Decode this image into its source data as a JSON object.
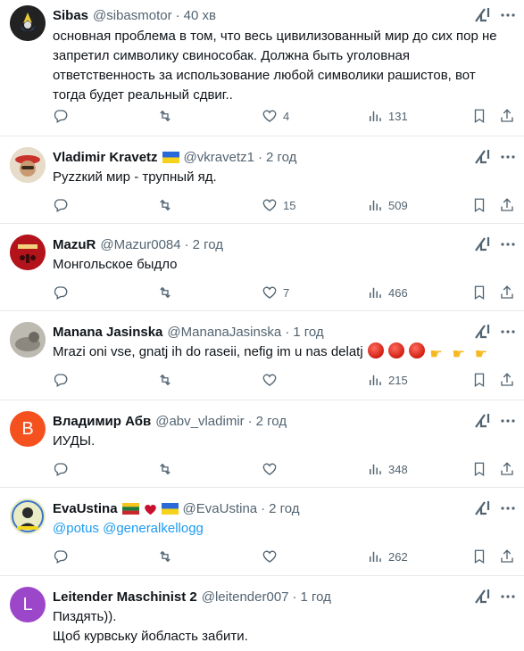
{
  "tweets": [
    {
      "name": "Sibas",
      "handle": "@sibasmotor",
      "time": "40 хв",
      "text": "основная проблема в том, что весь цивилизованный мир  до сих пор не запретил символику свинособак. Должна быть уголовная ответственность за использование любой символики рашистов, вот тогда будет реальный сдвиг..",
      "likes": "4",
      "views": "131"
    },
    {
      "name": "Vladimir Kravetz",
      "handle": "@vkravetz1",
      "time": "2 год",
      "text": "Руzzкий мир - трупный яд.",
      "likes": "15",
      "views": "509"
    },
    {
      "name": "MazuR",
      "handle": "@Mazur0084",
      "time": "2 год",
      "text": "Монгольское быдло",
      "likes": "7",
      "views": "466"
    },
    {
      "name": "Manana Jasinska",
      "handle": "@MananaJasinska",
      "time": "1 год",
      "text": "Mrazi oni vse, gnatj ih do raseii, nefig im u nas delatj",
      "likes": "",
      "views": "215"
    },
    {
      "name": "Владимир Абв",
      "handle": "@abv_vladimir",
      "time": "2 год",
      "text": "ИУДЫ.",
      "likes": "",
      "views": "348",
      "avatar_letter": "В"
    },
    {
      "name": "EvaUstina",
      "handle": "@EvaUstina",
      "time": "2 год",
      "mention1": "@potus",
      "mention2": "@generalkellogg",
      "likes": "",
      "views": "262"
    },
    {
      "name": "Leitender Maschinist 2",
      "handle": "@leitender007",
      "time": "1 год",
      "text_line1": "Пиздять)).",
      "text_line2": "Щоб курвську йобласть забити.",
      "avatar_letter": "L"
    }
  ],
  "separator": "·",
  "colors": {
    "text": "#0f1419",
    "secondary": "#536471",
    "link": "#1d9bf0",
    "divider": "#e6e9ec",
    "avatar_orange": "#f4511e",
    "avatar_purple": "#9c47c9"
  }
}
